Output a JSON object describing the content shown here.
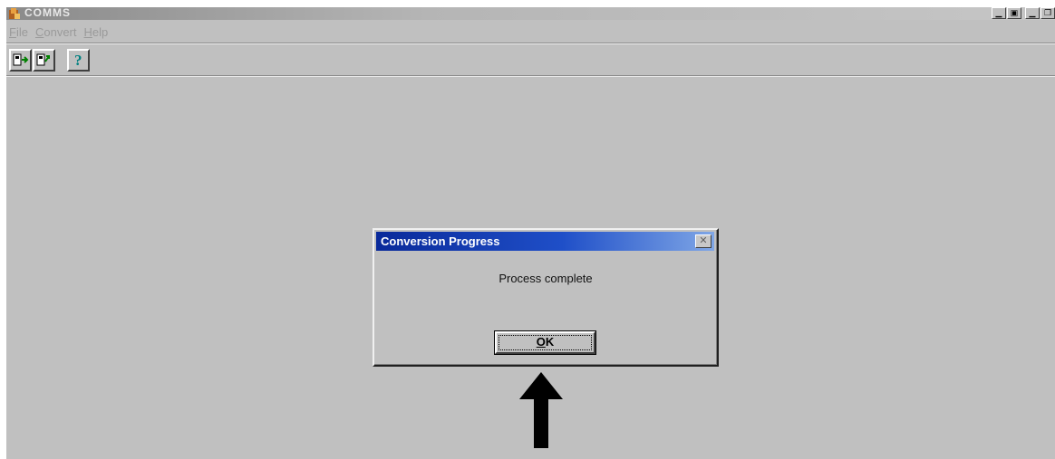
{
  "window": {
    "title": "COMMS",
    "controls": [
      "minimize",
      "maximize",
      "minimize",
      "restore"
    ]
  },
  "menu": {
    "items": [
      {
        "label": "File",
        "underline": "F",
        "rest": "ile"
      },
      {
        "label": "Convert",
        "underline": "C",
        "rest": "onvert"
      },
      {
        "label": "Help",
        "underline": "H",
        "rest": "elp"
      }
    ]
  },
  "toolbar": {
    "buttons": [
      "import-icon",
      "export-icon",
      "help-icon"
    ]
  },
  "dialog": {
    "title": "Conversion Progress",
    "message": "Process complete",
    "ok_underline": "O",
    "ok_rest": "K",
    "title_color": "#0a2a9a"
  },
  "colors": {
    "desktop": "#c0c0c0",
    "menu_text_disabled": "#9a9a9a",
    "arrow": "#000000"
  }
}
